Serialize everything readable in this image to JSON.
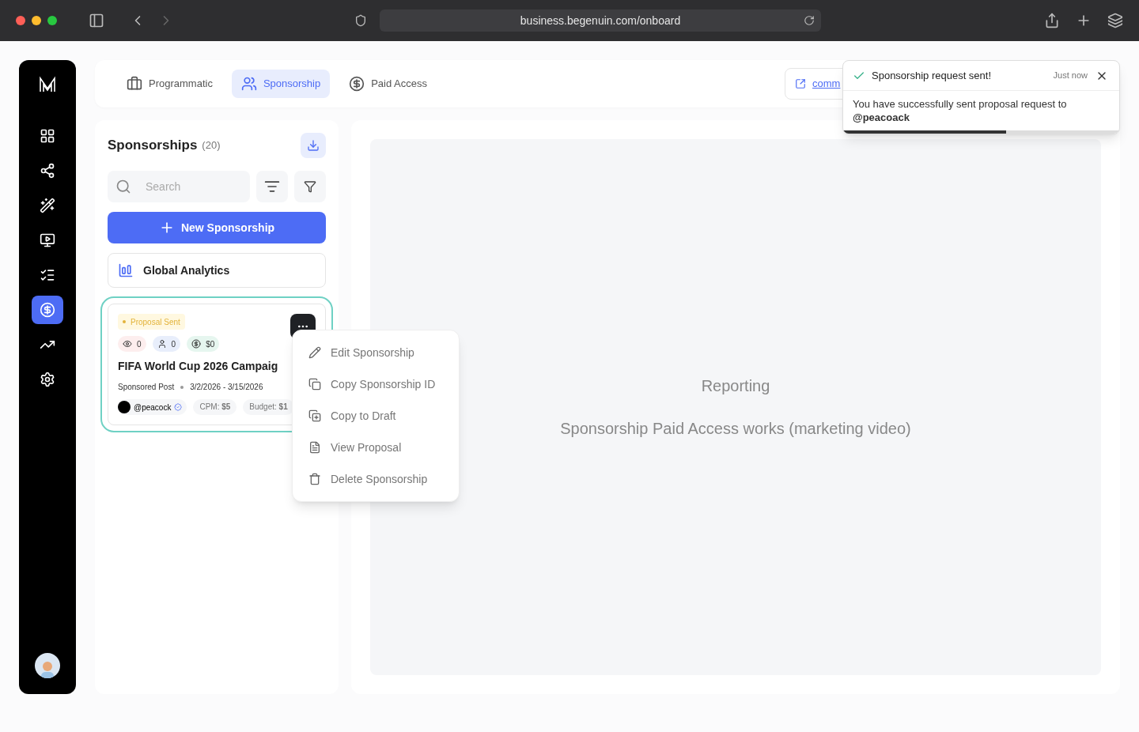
{
  "browser": {
    "url": "business.begenuin.com/onboard"
  },
  "sidebar": {
    "items": [
      {
        "kind": "grid",
        "selected": false
      },
      {
        "kind": "network",
        "selected": false
      },
      {
        "kind": "wand",
        "selected": false
      },
      {
        "kind": "video",
        "selected": false
      },
      {
        "kind": "checklist",
        "selected": false
      },
      {
        "kind": "dollar",
        "selected": true
      },
      {
        "kind": "trend",
        "selected": false
      },
      {
        "kind": "settings",
        "selected": false
      }
    ]
  },
  "tabs": [
    {
      "label": "Programmatic",
      "kind": "briefcase",
      "selected": false
    },
    {
      "label": "Sponsorship",
      "kind": "people",
      "selected": true
    },
    {
      "label": "Paid Access",
      "kind": "dollar",
      "selected": false
    }
  ],
  "top_link": {
    "label": "comm"
  },
  "toast": {
    "title": "Sponsorship request sent!",
    "time": "Just now",
    "message": "You have successfully sent proposal request to **@peacoack**",
    "level": 0.59
  },
  "panel": {
    "title": "Sponsorships",
    "count": "(20)",
    "search": {
      "placeholder": "Search"
    },
    "new_button": "New Sponsorship",
    "analytics": "Global Analytics"
  },
  "cards": [
    {
      "selected": true,
      "status": "Proposal Sent",
      "stats": [
        {
          "kind": "views",
          "value": "0"
        },
        {
          "kind": "people",
          "value": "0"
        },
        {
          "kind": "money",
          "value": "$0"
        }
      ],
      "title": "FIFA World Cup 2026 Campaig",
      "type": "Sponsored Post",
      "dates": "3/2/2026 - 3/15/2026",
      "handle": "@peacock",
      "cpm": "CPM: **$5**",
      "budget": "Budget: **$1**"
    }
  ],
  "menu": [
    {
      "kind": "edit",
      "label": "Edit Sponsorship"
    },
    {
      "kind": "copy",
      "label": "Copy Sponsorship ID"
    },
    {
      "kind": "draft",
      "label": "Copy to Draft"
    },
    {
      "kind": "view",
      "label": "View Proposal"
    },
    {
      "kind": "delete",
      "label": "Delete Sponsorship"
    }
  ],
  "reporting": {
    "title": "Reporting",
    "subtitle": "Sponsorship Paid Access works (marketing video)"
  }
}
